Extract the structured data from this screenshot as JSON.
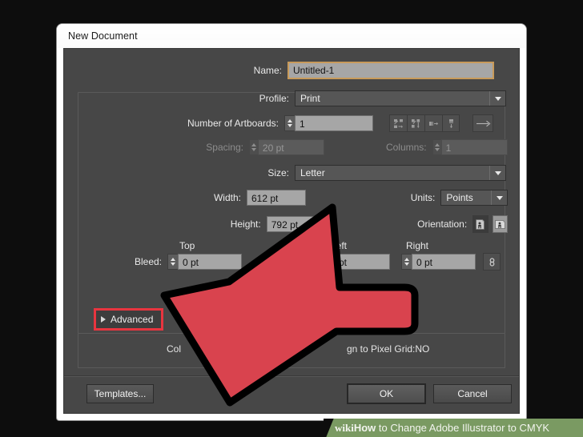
{
  "window": {
    "title": "New Document"
  },
  "fields": {
    "name_label": "Name:",
    "name_value": "Untitled-1",
    "profile_label": "Profile:",
    "profile_value": "Print",
    "artboards_label": "Number of Artboards:",
    "artboards_value": "1",
    "spacing_label": "Spacing:",
    "spacing_value": "20 pt",
    "columns_label": "Columns:",
    "columns_value": "1",
    "size_label": "Size:",
    "size_value": "Letter",
    "width_label": "Width:",
    "width_value": "612 pt",
    "units_label": "Units:",
    "units_value": "Points",
    "height_label": "Height:",
    "height_value": "792 pt",
    "orientation_label": "Orientation:",
    "bleed_label": "Bleed:",
    "bleed_top_label": "Top",
    "bleed_top_value": "0 pt",
    "bleed_left_label": "Left",
    "bleed_left_value": "0 pt",
    "bleed_right_label": "Right",
    "bleed_right_value": "0 pt"
  },
  "advanced": {
    "label": "Advanced",
    "color_mode_partial": "Col",
    "pixel_grid_partial": "gn to Pixel Grid:NO"
  },
  "footer": {
    "templates_label": "Templates...",
    "ok_label": "OK",
    "cancel_label": "Cancel"
  },
  "watermark": {
    "wiki": "wiki",
    "how": "How",
    "rest": " to Change Adobe Illustrator to CMYK"
  },
  "colors": {
    "highlight_red": "#e8353f",
    "arrow_red": "#d9434e",
    "arrow_outline": "#000000",
    "focus_border": "#c89a5a",
    "dialog_bg": "#474747",
    "watermark_green": "#7a9a62"
  }
}
